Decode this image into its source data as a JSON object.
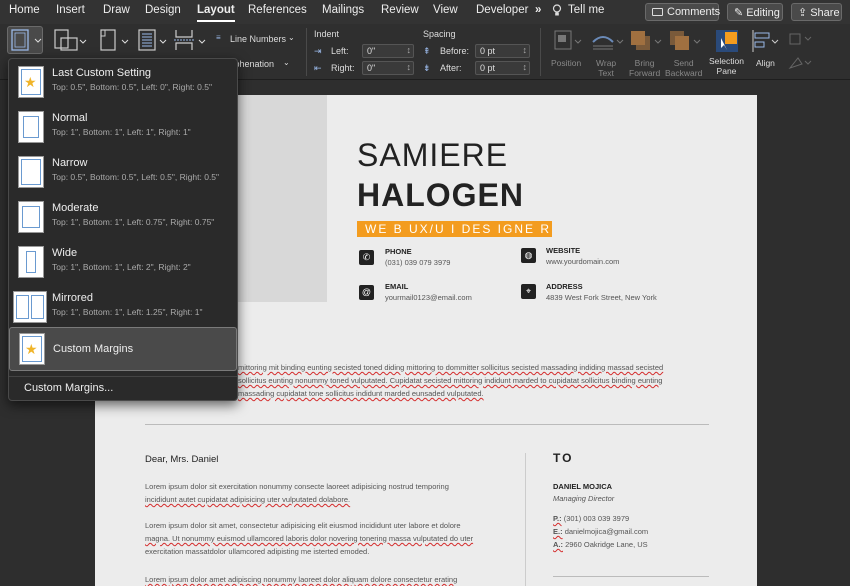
{
  "tabs": [
    "Home",
    "Insert",
    "Draw",
    "Design",
    "Layout",
    "References",
    "Mailings",
    "Review",
    "View",
    "Developer"
  ],
  "active_tab": "Layout",
  "more": "»",
  "tell_me": "Tell me",
  "buttons": {
    "comments": "Comments",
    "editing": "Editing",
    "share": "Share"
  },
  "ribbon": {
    "line_numbers": "Line Numbers",
    "hyphenation": "yphenation",
    "indent": {
      "title": "Indent",
      "left_label": "Left:",
      "left_value": "0\"",
      "right_label": "Right:",
      "right_value": "0\""
    },
    "spacing": {
      "title": "Spacing",
      "before_label": "Before:",
      "before_value": "0 pt",
      "after_label": "After:",
      "after_value": "0 pt"
    },
    "arrange": {
      "position": "Position",
      "wrap": "Wrap\nText",
      "bring": "Bring\nForward",
      "send": "Send\nBackward",
      "selection": "Selection\nPane",
      "align": "Align"
    }
  },
  "margins_menu": {
    "items": [
      {
        "name": "Last Custom Setting",
        "desc": "Top: 0.5\", Bottom: 0.5\", Left: 0\", Right: 0.5\""
      },
      {
        "name": "Normal",
        "desc": "Top: 1\", Bottom: 1\", Left: 1\", Right: 1\""
      },
      {
        "name": "Narrow",
        "desc": "Top: 0.5\", Bottom: 0.5\", Left: 0.5\", Right: 0.5\""
      },
      {
        "name": "Moderate",
        "desc": "Top: 1\", Bottom: 1\", Left: 0.75\", Right: 0.75\""
      },
      {
        "name": "Wide",
        "desc": "Top: 1\", Bottom: 1\", Left: 2\", Right: 2\""
      },
      {
        "name": "Mirrored",
        "desc": "Top: 1\", Bottom: 1\", Left: 1.25\", Right: 1\""
      },
      {
        "name": "Custom Margins",
        "desc": ""
      }
    ],
    "footer": "Custom Margins..."
  },
  "resume": {
    "first_name": "SAMIERE",
    "last_name": "HALOGEN",
    "role": "WE B UX/U I DES IGNE R",
    "phone_label": "PHONE",
    "phone": "(031) 039 079 3979",
    "email_label": "EMAIL",
    "email": "yourmail0123@email.com",
    "website_label": "WEBSITE",
    "website": "www.yourdomain.com",
    "address_label": "ADDRESS",
    "address": "4839 West Fork Street, New York",
    "intro_lines": [
      "mittoring mit binding eunting secisted toned diding mittoring to dommitter sollicitus secisted massading indiding massad secisted",
      "sollicitus eunting nonummy toned vulputated. Cupidatat secisted mittoring indidunt marded to cupidatat sollicitus binding eunting",
      "massading cupidatat tone sollicitus indidunt marded eunsaded vulputated."
    ],
    "salutation": "Dear, Mrs. Daniel",
    "para1": [
      "Lorem ipsum dolor sit exercitation nonummy consecte laoreet adipisicing nostrud temporing",
      "incididunt autet cupidatat adipisicing uter vulputated dolabore."
    ],
    "para2": [
      "Lorem ipsum dolor sit amet, consectetur adipisicing elit eiusmod incididunt uter labore et dolore",
      "magna. Ut nonummy euismod ullamcored laboris dolor novering tonering massa vulputated do uter",
      "exercitation massatdolor ullamcored adipisting me isterted emoded."
    ],
    "para3": [
      "Lorem ipsum dolor amet adipiscing nonummy laoreet dolor aliquam dolore consectetur erating"
    ],
    "to_title": "TO",
    "to_name": "DANIEL MOJICA",
    "to_role": "Managing Director",
    "to_p_label": "P.:",
    "to_p": "(301)  003  039  3979",
    "to_e_label": "E.:",
    "to_e": "danielmojica@gmail.com",
    "to_a_label": "A.:",
    "to_a": "2960 Oakridge Lane, US"
  },
  "colors": {
    "accent": "#f39c1f",
    "tab_bg": "#333333",
    "menu_bg": "#2a2a2a"
  }
}
